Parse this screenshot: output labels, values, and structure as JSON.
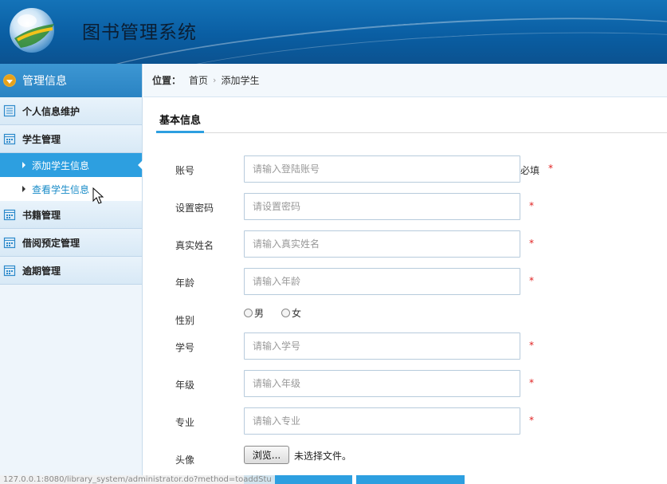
{
  "header": {
    "title": "图书管理系统"
  },
  "sidebar": {
    "heading": "管理信息",
    "items": [
      {
        "label": "个人信息维护",
        "icon": "list-icon"
      },
      {
        "label": "学生管理",
        "icon": "calendar-icon"
      },
      {
        "label": "书籍管理",
        "icon": "calendar-icon"
      },
      {
        "label": "借阅预定管理",
        "icon": "calendar-icon"
      },
      {
        "label": "逾期管理",
        "icon": "calendar-icon"
      }
    ],
    "sub_items": [
      {
        "label": "添加学生信息",
        "state": "active"
      },
      {
        "label": "查看学生信息",
        "state": "hover"
      }
    ]
  },
  "breadcrumb": {
    "label": "位置：",
    "home": "首页",
    "current": "添加学生"
  },
  "tab": {
    "label": "基本信息"
  },
  "form": {
    "account": {
      "label": "账号",
      "placeholder": "请输入登陆账号",
      "note": "必填",
      "required": "*"
    },
    "password": {
      "label": "设置密码",
      "placeholder": "请设置密码",
      "required": "*"
    },
    "realname": {
      "label": "真实姓名",
      "placeholder": "请输入真实姓名",
      "required": "*"
    },
    "age": {
      "label": "年龄",
      "placeholder": "请输入年龄",
      "required": "*"
    },
    "gender": {
      "label": "性别",
      "options": [
        "男",
        "女"
      ]
    },
    "student_no": {
      "label": "学号",
      "placeholder": "请输入学号",
      "required": "*"
    },
    "grade": {
      "label": "年级",
      "placeholder": "请输入年级",
      "required": "*"
    },
    "major": {
      "label": "专业",
      "placeholder": "请输入专业",
      "required": "*"
    },
    "avatar": {
      "label": "头像",
      "button": "浏览...",
      "status": "未选择文件。"
    }
  },
  "statusbar": {
    "url": "127.0.0.1:8080/library_system/administrator.do?method=toaddStu"
  },
  "colors": {
    "accent": "#2d9fe0",
    "header": "#0a5ea3",
    "required": "#e02020"
  }
}
